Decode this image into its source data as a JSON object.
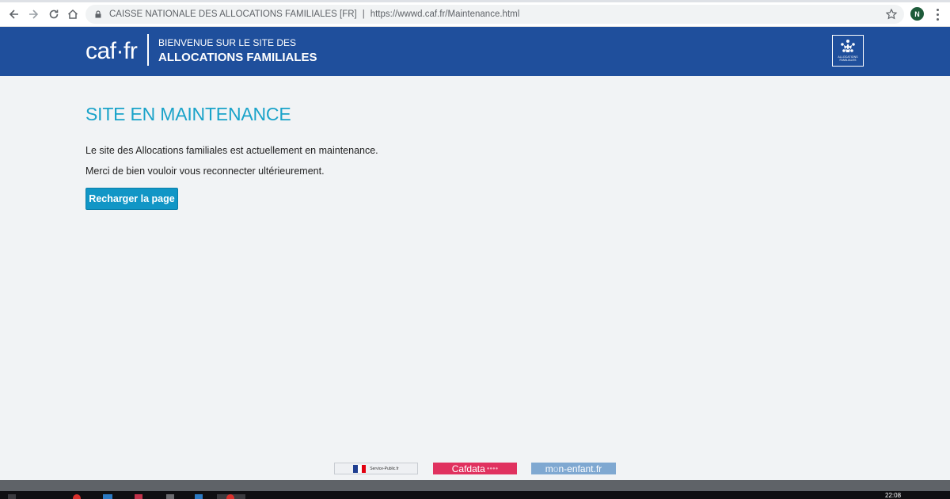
{
  "browser": {
    "site_name": "CAISSE NATIONALE DES ALLOCATIONS FAMILIALES [FR]",
    "separator": "|",
    "url": "https://wwwd.caf.fr/Maintenance.html",
    "profile_initial": "N",
    "icons": [
      "back-arrow-icon",
      "forward-arrow-icon",
      "reload-icon",
      "home-icon",
      "lock-icon",
      "star-icon",
      "kebab-menu-icon"
    ]
  },
  "header": {
    "logo_text": "caf·fr",
    "welcome_line1": "BIENVENUE SUR LE SITE DES",
    "welcome_line2": "ALLOCATIONS FAMILIALES",
    "emblem_caption": "ALLOCATIONS FAMILIALES",
    "bg_color": "#1f4f9c"
  },
  "main": {
    "title": "SITE EN MAINTENANCE",
    "paragraph1": "Le site des Allocations familiales est actuellement en maintenance.",
    "paragraph2": "Merci de bien vouloir vous reconnecter ultérieurement.",
    "reload_button": "Recharger la page",
    "title_color": "#1aa3c9",
    "button_color": "#1196c6"
  },
  "footer": {
    "partners": {
      "service_public": "Service-Public.fr",
      "cafdata": "Cafdata",
      "cafdata_dots": "●●●●",
      "monenfant_pre": "m",
      "monenfant_o": "o",
      "monenfant_post": "n-enfant.fr"
    }
  },
  "taskbar": {
    "clock": "22:08"
  }
}
